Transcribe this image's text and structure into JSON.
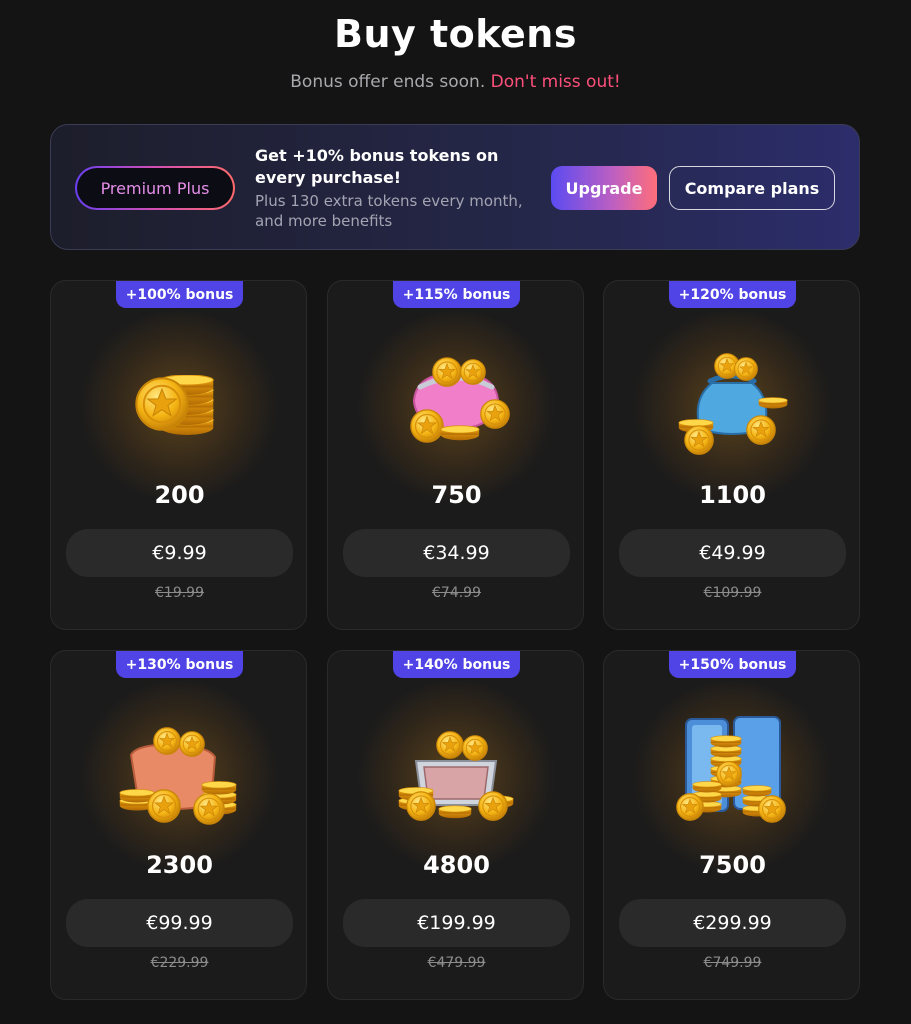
{
  "header": {
    "title": "Buy tokens",
    "subtitle_prefix": "Bonus offer ends soon.",
    "subtitle_highlight": "Don't miss out!"
  },
  "banner": {
    "badge": "Premium Plus",
    "headline": "Get +10% bonus tokens on every purchase!",
    "description": "Plus 130 extra tokens every month, and more benefits",
    "upgrade_label": "Upgrade",
    "compare_label": "Compare plans"
  },
  "packages": [
    {
      "bonus": "+100% bonus",
      "amount": "200",
      "price": "€9.99",
      "old_price": "€19.99",
      "icon": "coin-stack-icon"
    },
    {
      "bonus": "+115% bonus",
      "amount": "750",
      "price": "€34.99",
      "old_price": "€74.99",
      "icon": "coin-purse-icon"
    },
    {
      "bonus": "+120% bonus",
      "amount": "1100",
      "price": "€49.99",
      "old_price": "€109.99",
      "icon": "coin-bag-icon"
    },
    {
      "bonus": "+130% bonus",
      "amount": "2300",
      "price": "€99.99",
      "old_price": "€229.99",
      "icon": "coin-sack-icon"
    },
    {
      "bonus": "+140% bonus",
      "amount": "4800",
      "price": "€199.99",
      "old_price": "€479.99",
      "icon": "coin-box-icon"
    },
    {
      "bonus": "+150% bonus",
      "amount": "7500",
      "price": "€299.99",
      "old_price": "€749.99",
      "icon": "coin-vault-icon"
    }
  ],
  "colors": {
    "background": "#141414",
    "card": "#1b1b1b",
    "bonus_badge": "#5144e6",
    "highlight": "#ff4f7b",
    "coin_gold": "#f5b514"
  }
}
